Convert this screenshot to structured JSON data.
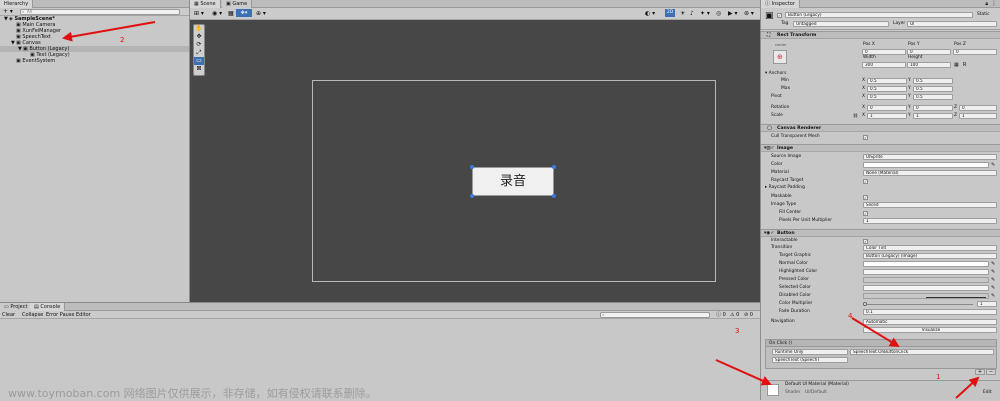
{
  "hierarchy": {
    "tab": "Hierarchy",
    "search_placeholder": "All",
    "items": [
      {
        "label": "SampleScene*",
        "bold": true,
        "indent": 0,
        "arrow": "▼"
      },
      {
        "label": "Main Camera",
        "indent": 1,
        "arrow": ""
      },
      {
        "label": "XunFeiManager",
        "indent": 1,
        "arrow": ""
      },
      {
        "label": "SpeechText",
        "indent": 1,
        "arrow": ""
      },
      {
        "label": "Canvas",
        "indent": 1,
        "arrow": "▼"
      },
      {
        "label": "Button (Legacy)",
        "indent": 2,
        "arrow": "▼",
        "selected": true
      },
      {
        "label": "Text (Legacy)",
        "indent": 3,
        "arrow": ""
      },
      {
        "label": "EventSystem",
        "indent": 1,
        "arrow": ""
      }
    ]
  },
  "scene": {
    "tabs": [
      "Scene",
      "Game"
    ],
    "button_text": "录音",
    "toolbar_2d": "2D"
  },
  "console": {
    "tabs": [
      "Project",
      "Console"
    ],
    "buttons": [
      "Clear",
      "Collapse",
      "Error Pause",
      "Editor"
    ],
    "counts": [
      "0",
      "0",
      "0"
    ]
  },
  "inspector": {
    "tab": "Inspector",
    "object_name": "Button (Legacy)",
    "static_label": "Static",
    "tag_label": "Tag",
    "tag_value": "Untagged",
    "layer_label": "Layer",
    "layer_value": "UI",
    "rect_transform": {
      "title": "Rect Transform",
      "anchor_label": "center",
      "headers": [
        "Pos X",
        "Pos Y",
        "Pos Z"
      ],
      "pos": [
        "0",
        "0",
        "0"
      ],
      "size_headers": [
        "Width",
        "Height"
      ],
      "size": [
        "300",
        "100"
      ],
      "anchors_label": "Anchors",
      "min_label": "Min",
      "min": [
        "0.5",
        "0.5"
      ],
      "max_label": "Max",
      "max": [
        "0.5",
        "0.5"
      ],
      "pivot_label": "Pivot",
      "pivot": [
        "0.5",
        "0.5"
      ],
      "rotation_label": "Rotation",
      "rotation": [
        "0",
        "0",
        "0"
      ],
      "scale_label": "Scale",
      "scale": [
        "1",
        "1",
        "1"
      ],
      "axis_letters": [
        "X",
        "Y",
        "Z"
      ]
    },
    "canvas_renderer": {
      "title": "Canvas Renderer",
      "cull_label": "Cull Transparent Mesh"
    },
    "image": {
      "title": "Image",
      "source_label": "Source Image",
      "source_value": "UISprite",
      "color_label": "Color",
      "material_label": "Material",
      "material_value": "None (Material)",
      "raycast_label": "Raycast Target",
      "padding_label": "Raycast Padding",
      "maskable_label": "Maskable",
      "type_label": "Image Type",
      "type_value": "Sliced",
      "fill_label": "Fill Center",
      "ppu_label": "Pixels Per Unit Multiplier",
      "ppu_value": "1"
    },
    "button": {
      "title": "Button",
      "interactable_label": "Interactable",
      "transition_label": "Transition",
      "transition_value": "Color Tint",
      "target_label": "Target Graphic",
      "target_value": "Button (Legacy) (Image)",
      "normal_label": "Normal Color",
      "highlighted_label": "Highlighted Color",
      "pressed_label": "Pressed Color",
      "selected_label": "Selected Color",
      "disabled_label": "Disabled Color",
      "multiplier_label": "Color Multiplier",
      "multiplier_value": "1",
      "fade_label": "Fade Duration",
      "fade_value": "0.1",
      "navigation_label": "Navigation",
      "navigation_value": "Automatic",
      "visualize_label": "Visualize",
      "onclick_label": "On Click ()",
      "runtime_value": "Runtime Only",
      "function_value": "SpeechText.OnButtonClick",
      "object_value": "SpeechText (SpeechT"
    },
    "material": {
      "title": "Default UI Material (Material)",
      "shader_label": "Shader",
      "shader_value": "UI/Default",
      "edit_label": "Edit"
    }
  },
  "annotations": [
    "1",
    "2",
    "3",
    "4"
  ],
  "watermark": "www.toymoban.com 网络图片仅供展示，非存储，如有侵权请联系删除。"
}
